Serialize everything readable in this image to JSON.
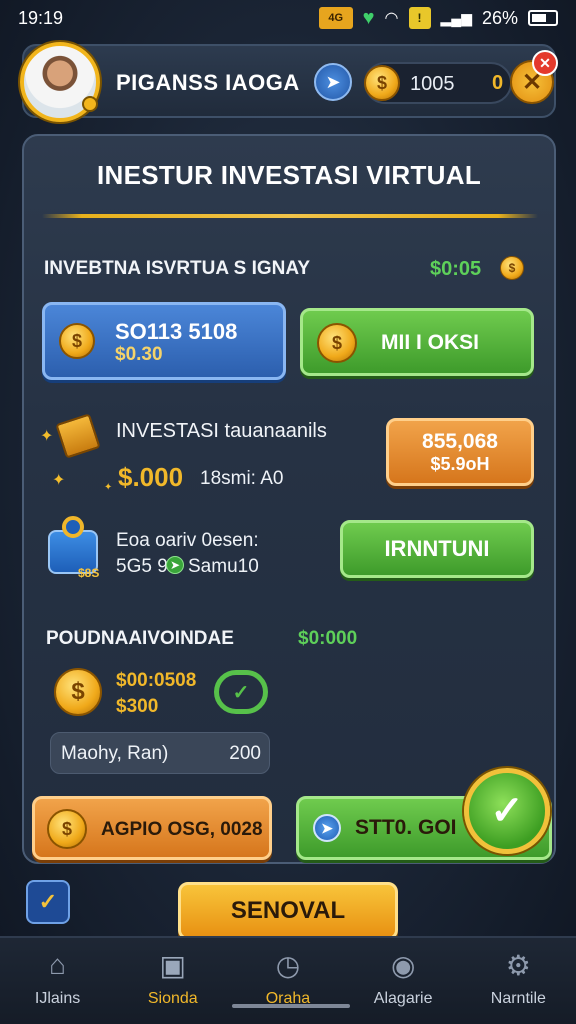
{
  "status_bar": {
    "time": "19:19",
    "badge_text": "4G",
    "battery_pct": "26%"
  },
  "header": {
    "player_name": "PIGANSS IAOGA",
    "coin_amount": "1005",
    "secondary_amount": "0"
  },
  "panel": {
    "title": "INESTUR INVESTASI VIRTUAL",
    "row1": {
      "label": "INVEBTNA ISVRTUA S IGNAY",
      "value": "$0:05",
      "left_button": {
        "line1": "SO113 5108",
        "line2": "$0.30"
      },
      "right_button": {
        "label": "MII I OKSI"
      }
    },
    "row2": {
      "label": "INVESTASI tauanaanils",
      "amount": "$.000",
      "sub": "18smi: A0",
      "button": {
        "line1": "855,068",
        "line2": "$5.9oH"
      }
    },
    "row3": {
      "line1": "Eoa oariv 0esen:",
      "line2": "5G5 9",
      "line3": "Samu10",
      "wallet_tag": "$8S",
      "button_label": "IRNNTUNI"
    },
    "section": {
      "label": "POUDNAAIVOINDAE",
      "value": "$0:000",
      "coin_line1": "$00:0508",
      "coin_line2": "$300",
      "input_label": "Maohy, Ran)",
      "input_value": "200"
    },
    "bottom_buttons": {
      "left_label": "AGPIO OSG, 0028",
      "right_label": "STT0. GOI"
    }
  },
  "footer": {
    "cta_label": "SENOVAL"
  },
  "nav": {
    "items": [
      {
        "label": "IJlains",
        "icon": "home-icon"
      },
      {
        "label": "Sionda",
        "icon": "chart-icon"
      },
      {
        "label": "Oraha",
        "icon": "clock-icon"
      },
      {
        "label": "Alagarie",
        "icon": "target-icon"
      },
      {
        "label": "Narntile",
        "icon": "gear-icon"
      }
    ],
    "active_index": 1
  },
  "colors": {
    "accent_gold": "#f1b82a",
    "accent_green": "#5ed05a",
    "panel_bg": "#263244",
    "blue_button": "#2c5fae",
    "green_button": "#3e9b2b",
    "orange_button": "#d6761c"
  }
}
